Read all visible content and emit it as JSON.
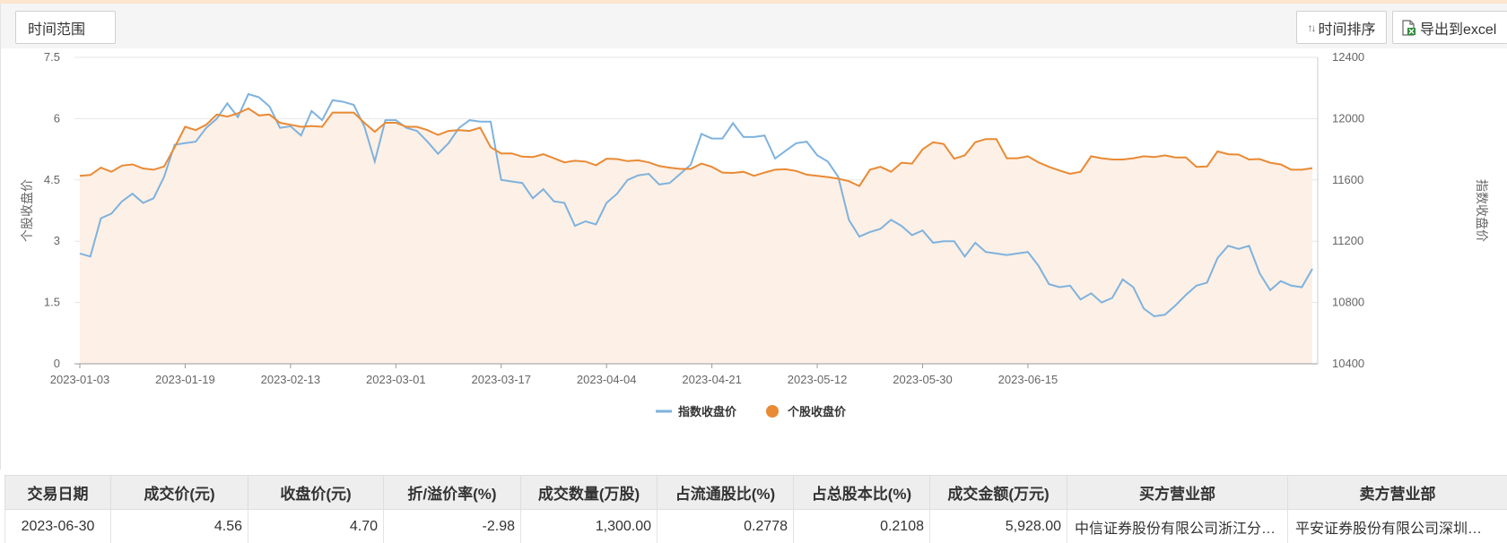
{
  "toolbar": {
    "range_label": "时间范围",
    "sort_label": "时间排序",
    "sort_icon": "sort-arrows-icon",
    "export_label": "导出到excel",
    "export_icon": "excel-export-icon"
  },
  "colors": {
    "index_line": "#7fb2dd",
    "stock_line": "#e98a34",
    "area_fill": "#fdf0e6",
    "grid": "#e6e6e6",
    "axis_text": "#666666"
  },
  "chart_data": {
    "type": "line",
    "title": "",
    "ylabel": "个股收盘价",
    "y2label": "指数收盘价",
    "ylim": [
      0,
      7.5
    ],
    "y2lim": [
      10400,
      12400
    ],
    "yticks": [
      "0",
      "1.5",
      "3",
      "4.5",
      "6",
      "7.5"
    ],
    "y2ticks": [
      "10400",
      "10800",
      "11200",
      "11600",
      "12000",
      "12400"
    ],
    "x_tick_labels": [
      {
        "label": "2023-01-03",
        "index": 0
      },
      {
        "label": "2023-01-19",
        "index": 10
      },
      {
        "label": "2023-02-13",
        "index": 20
      },
      {
        "label": "2023-03-01",
        "index": 30
      },
      {
        "label": "2023-03-17",
        "index": 40
      },
      {
        "label": "2023-04-04",
        "index": 50
      },
      {
        "label": "2023-04-21",
        "index": 60
      },
      {
        "label": "2023-05-12",
        "index": 70
      },
      {
        "label": "2023-05-30",
        "index": 80
      },
      {
        "label": "2023-06-15",
        "index": 90
      }
    ],
    "legend_position": "bottom-center",
    "series": [
      {
        "name": "指数收盘价",
        "axis": "right",
        "values": [
          11120,
          11100,
          11350,
          11380,
          11460,
          11510,
          11450,
          11480,
          11620,
          11830,
          11840,
          11850,
          11940,
          12000,
          12100,
          12010,
          12160,
          12140,
          12080,
          11940,
          11950,
          11890,
          12050,
          11990,
          12120,
          12110,
          12090,
          11950,
          11720,
          11990,
          11990,
          11940,
          11920,
          11850,
          11770,
          11840,
          11940,
          11990,
          11980,
          11980,
          11600,
          11590,
          11580,
          11480,
          11540,
          11460,
          11450,
          11300,
          11330,
          11310,
          11450,
          11510,
          11600,
          11630,
          11640,
          11570,
          11580,
          11640,
          11700,
          11900,
          11870,
          11870,
          11970,
          11880,
          11880,
          11890,
          11740,
          11790,
          11840,
          11850,
          11760,
          11720,
          11620,
          11340,
          11230,
          11260,
          11280,
          11340,
          11300,
          11240,
          11270,
          11190,
          11200,
          11200,
          11100,
          11190,
          11130,
          11120,
          11110,
          11120,
          11130,
          11040,
          10920,
          10900,
          10910,
          10820,
          10860,
          10800,
          10830,
          10950,
          10900,
          10760,
          10710,
          10720,
          10780,
          10850,
          10910,
          10930,
          11090,
          11170,
          11150,
          11170,
          10990,
          10880,
          10940,
          10910,
          10900,
          11020
        ]
      },
      {
        "name": "个股收盘价",
        "axis": "left",
        "values": [
          4.6,
          4.62,
          4.8,
          4.7,
          4.85,
          4.88,
          4.78,
          4.75,
          4.83,
          5.3,
          5.8,
          5.72,
          5.85,
          6.1,
          6.05,
          6.13,
          6.25,
          6.08,
          6.1,
          5.9,
          5.85,
          5.8,
          5.82,
          5.8,
          6.15,
          6.15,
          6.15,
          5.9,
          5.68,
          5.9,
          5.9,
          5.8,
          5.8,
          5.72,
          5.6,
          5.7,
          5.72,
          5.7,
          5.78,
          5.3,
          5.15,
          5.15,
          5.07,
          5.06,
          5.13,
          5.03,
          4.93,
          4.97,
          4.95,
          4.86,
          5.02,
          5.01,
          4.96,
          4.98,
          4.93,
          4.84,
          4.8,
          4.77,
          4.77,
          4.9,
          4.82,
          4.68,
          4.67,
          4.7,
          4.6,
          4.68,
          4.75,
          4.76,
          4.72,
          4.63,
          4.6,
          4.57,
          4.53,
          4.47,
          4.35,
          4.75,
          4.82,
          4.7,
          4.92,
          4.9,
          5.25,
          5.42,
          5.38,
          5.02,
          5.1,
          5.42,
          5.5,
          5.5,
          5.03,
          5.03,
          5.08,
          4.93,
          4.82,
          4.73,
          4.65,
          4.7,
          5.08,
          5.03,
          5.0,
          5.0,
          5.03,
          5.08,
          5.06,
          5.1,
          5.05,
          5.05,
          4.82,
          4.83,
          5.2,
          5.13,
          5.12,
          5.0,
          5.01,
          4.92,
          4.88,
          4.75,
          4.75,
          4.79
        ]
      }
    ]
  },
  "table": {
    "headers": [
      "交易日期",
      "成交价(元)",
      "收盘价(元)",
      "折/溢价率(%)",
      "成交数量(万股)",
      "占流通股比(%)",
      "占总股本比(%)",
      "成交金额(万元)",
      "买方营业部",
      "卖方营业部"
    ],
    "rows": [
      [
        "2023-06-30",
        "4.56",
        "4.70",
        "-2.98",
        "1,300.00",
        "0.2778",
        "0.2108",
        "5,928.00",
        "中信证券股份有限公司浙江分…",
        "平安证券股份有限公司深圳…"
      ]
    ]
  }
}
